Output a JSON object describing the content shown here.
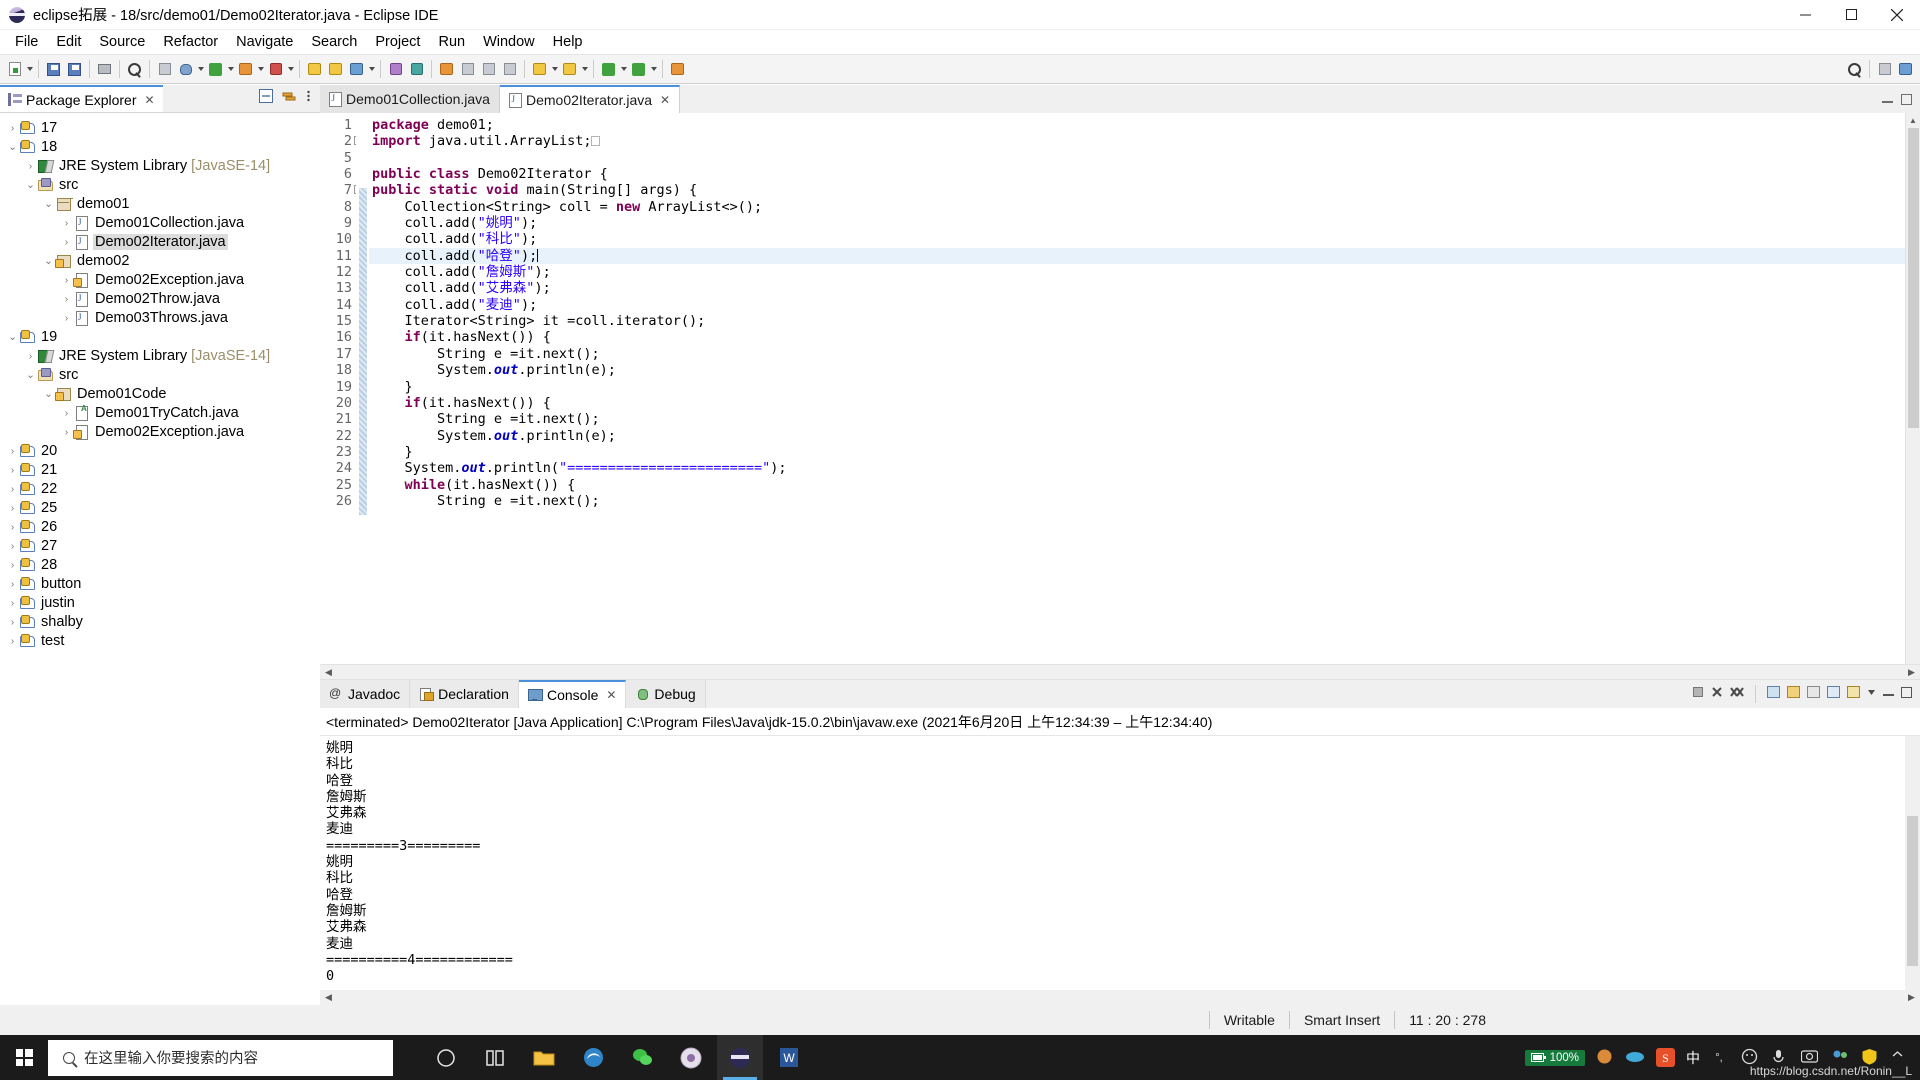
{
  "window": {
    "title": "eclipse拓展 - 18/src/demo01/Demo02Iterator.java - Eclipse IDE",
    "icon": "eclipse-icon",
    "minimize": "─",
    "maximize": "□",
    "close": "✕"
  },
  "menu": [
    {
      "label": "File"
    },
    {
      "label": "Edit"
    },
    {
      "label": "Source"
    },
    {
      "label": "Refactor"
    },
    {
      "label": "Navigate"
    },
    {
      "label": "Search"
    },
    {
      "label": "Project"
    },
    {
      "label": "Run"
    },
    {
      "label": "Window"
    },
    {
      "label": "Help"
    }
  ],
  "explorer": {
    "tab_label": "Package Explorer",
    "tab_close": "✕",
    "tools": [
      "collapse-all-icon",
      "link-with-editor-icon",
      "view-menu-icon"
    ],
    "tree": [
      {
        "indent": 0,
        "arrow": "›",
        "icon": "java-project-icon",
        "label": "17",
        "selected": false
      },
      {
        "indent": 0,
        "arrow": "∨",
        "icon": "java-project-icon",
        "label": "18",
        "selected": false
      },
      {
        "indent": 1,
        "arrow": "›",
        "icon": "jre-library-icon",
        "label": "JRE System Library ",
        "dim": "[JavaSE-14]",
        "selected": false
      },
      {
        "indent": 1,
        "arrow": "∨",
        "icon": "source-folder-icon",
        "label": "src",
        "selected": false
      },
      {
        "indent": 2,
        "arrow": "∨",
        "icon": "package-icon",
        "label": "demo01",
        "selected": false
      },
      {
        "indent": 3,
        "arrow": "›",
        "icon": "java-file-icon",
        "label": "Demo01Collection.java",
        "selected": false
      },
      {
        "indent": 3,
        "arrow": "›",
        "icon": "java-file-icon",
        "label": "Demo02Iterator.java",
        "selected": true
      },
      {
        "indent": 2,
        "arrow": "∨",
        "icon": "package-warning-icon",
        "label": "demo02",
        "selected": false
      },
      {
        "indent": 3,
        "arrow": "›",
        "icon": "java-file-warning-icon",
        "label": "Demo02Exception.java",
        "selected": false
      },
      {
        "indent": 3,
        "arrow": "›",
        "icon": "java-file-icon",
        "label": "Demo02Throw.java",
        "selected": false
      },
      {
        "indent": 3,
        "arrow": "›",
        "icon": "java-file-icon",
        "label": "Demo03Throws.java",
        "selected": false
      },
      {
        "indent": 0,
        "arrow": "∨",
        "icon": "java-project-icon",
        "label": "19",
        "selected": false
      },
      {
        "indent": 1,
        "arrow": "›",
        "icon": "jre-library-icon",
        "label": "JRE System Library ",
        "dim": "[JavaSE-14]",
        "selected": false
      },
      {
        "indent": 1,
        "arrow": "∨",
        "icon": "source-folder-icon",
        "label": "src",
        "selected": false
      },
      {
        "indent": 2,
        "arrow": "∨",
        "icon": "package-warning-icon",
        "label": "Demo01Code",
        "selected": false
      },
      {
        "indent": 3,
        "arrow": "›",
        "icon": "java-file-abstract-icon",
        "label": "Demo01TryCatch.java",
        "selected": false
      },
      {
        "indent": 3,
        "arrow": "›",
        "icon": "java-file-warning-icon",
        "label": "Demo02Exception.java",
        "selected": false
      },
      {
        "indent": 0,
        "arrow": "›",
        "icon": "java-project-icon",
        "label": "20",
        "selected": false
      },
      {
        "indent": 0,
        "arrow": "›",
        "icon": "java-project-icon",
        "label": "21",
        "selected": false
      },
      {
        "indent": 0,
        "arrow": "›",
        "icon": "java-project-icon",
        "label": "22",
        "selected": false
      },
      {
        "indent": 0,
        "arrow": "›",
        "icon": "java-project-icon",
        "label": "25",
        "selected": false
      },
      {
        "indent": 0,
        "arrow": "›",
        "icon": "java-project-icon",
        "label": "26",
        "selected": false
      },
      {
        "indent": 0,
        "arrow": "›",
        "icon": "java-project-icon",
        "label": "27",
        "selected": false
      },
      {
        "indent": 0,
        "arrow": "›",
        "icon": "java-project-icon",
        "label": "28",
        "selected": false
      },
      {
        "indent": 0,
        "arrow": "›",
        "icon": "java-project-icon",
        "label": "button",
        "selected": false
      },
      {
        "indent": 0,
        "arrow": "›",
        "icon": "java-project-icon",
        "label": "justin",
        "selected": false
      },
      {
        "indent": 0,
        "arrow": "›",
        "icon": "java-project-icon",
        "label": "shalby",
        "selected": false
      },
      {
        "indent": 0,
        "arrow": "›",
        "icon": "java-project-icon",
        "label": "test",
        "selected": false
      }
    ]
  },
  "editor": {
    "tabs": [
      {
        "label": "Demo01Collection.java",
        "active": false,
        "close": ""
      },
      {
        "label": "Demo02Iterator.java",
        "active": true,
        "close": "✕"
      }
    ],
    "lines": [
      {
        "num": "1",
        "fold": "",
        "current": false
      },
      {
        "num": "2",
        "fold": "⊕",
        "current": false
      },
      {
        "num": "5",
        "fold": "",
        "current": false
      },
      {
        "num": "6",
        "fold": "",
        "current": false
      },
      {
        "num": "7",
        "fold": "⊖",
        "current": false
      },
      {
        "num": "8",
        "fold": "",
        "current": false
      },
      {
        "num": "9",
        "fold": "",
        "current": false
      },
      {
        "num": "10",
        "fold": "",
        "current": false
      },
      {
        "num": "11",
        "fold": "",
        "current": true
      },
      {
        "num": "12",
        "fold": "",
        "current": false
      },
      {
        "num": "13",
        "fold": "",
        "current": false
      },
      {
        "num": "14",
        "fold": "",
        "current": false
      },
      {
        "num": "15",
        "fold": "",
        "current": false
      },
      {
        "num": "16",
        "fold": "",
        "current": false
      },
      {
        "num": "17",
        "fold": "",
        "current": false
      },
      {
        "num": "18",
        "fold": "",
        "current": false
      },
      {
        "num": "19",
        "fold": "",
        "current": false
      },
      {
        "num": "20",
        "fold": "",
        "current": false
      },
      {
        "num": "21",
        "fold": "",
        "current": false
      },
      {
        "num": "22",
        "fold": "",
        "current": false
      },
      {
        "num": "23",
        "fold": "",
        "current": false
      },
      {
        "num": "24",
        "fold": "",
        "current": false
      },
      {
        "num": "25",
        "fold": "",
        "current": false
      },
      {
        "num": "26",
        "fold": "",
        "current": false
      }
    ],
    "source_text": [
      "package demo01;",
      "import java.util.ArrayList;",
      "",
      "public class Demo02Iterator {",
      "public static void main(String[] args) {",
      "    Collection<String> coll = new ArrayList<>();",
      "    coll.add(\"姚明\");",
      "    coll.add(\"科比\");",
      "    coll.add(\"哈登\");",
      "    coll.add(\"詹姆斯\");",
      "    coll.add(\"艾弗森\");",
      "    coll.add(\"麦迪\");",
      "    Iterator<String> it =coll.iterator();",
      "    if(it.hasNext()) {",
      "        String e =it.next();",
      "        System.out.println(e);",
      "    }",
      "    if(it.hasNext()) {",
      "        String e =it.next();",
      "        System.out.println(e);",
      "    }",
      "    System.out.println(\"========================\");",
      "    while(it.hasNext()) {",
      "        String e =it.next();"
    ]
  },
  "console": {
    "tabs": [
      {
        "label": "Javadoc",
        "icon": "javadoc-icon",
        "active": false,
        "close": ""
      },
      {
        "label": "Declaration",
        "icon": "declaration-icon",
        "active": false,
        "close": ""
      },
      {
        "label": "Console",
        "icon": "console-icon",
        "active": true,
        "close": "✕"
      },
      {
        "label": "Debug",
        "icon": "debug-icon",
        "active": false,
        "close": ""
      }
    ],
    "header": "<terminated> Demo02Iterator [Java Application] C:\\Program Files\\Java\\jdk-15.0.2\\bin\\javaw.exe  (2021年6月20日 上午12:34:39 – 上午12:34:40)",
    "output": "姚明\n科比\n哈登\n詹姆斯\n艾弗森\n麦迪\n=========3=========\n姚明\n科比\n哈登\n詹姆斯\n艾弗森\n麦迪\n==========4============\n0",
    "tools": [
      "terminate-icon",
      "remove-launch-icon",
      "remove-all-icon",
      "open-console-icon",
      "scroll-lock-icon",
      "pin-console-icon",
      "display-selected-icon",
      "new-console-icon",
      "view-menu-icon",
      "minimize-icon",
      "maximize-icon"
    ]
  },
  "statusbar": {
    "writable": "Writable",
    "insert_mode": "Smart Insert",
    "position": "11 : 20 : 278"
  },
  "taskbar": {
    "search_placeholder": "在这里输入你要搜索的内容",
    "apps": [
      {
        "name": "task-view-icon"
      },
      {
        "name": "cortana-icon"
      },
      {
        "name": "file-explorer-icon"
      },
      {
        "name": "edge-icon"
      },
      {
        "name": "wechat-icon"
      },
      {
        "name": "media-player-icon"
      },
      {
        "name": "eclipse-taskbar-icon"
      },
      {
        "name": "word-icon"
      }
    ],
    "battery_percent": "100%",
    "ime_label": "中",
    "watermark": "https://blog.csdn.net/Ronin__L"
  },
  "colors": {
    "accent": "#4a90d9",
    "keyword": "#7f0055",
    "string": "#2a00ff",
    "field": "#0000c0",
    "selection": "#e8f2fb"
  }
}
